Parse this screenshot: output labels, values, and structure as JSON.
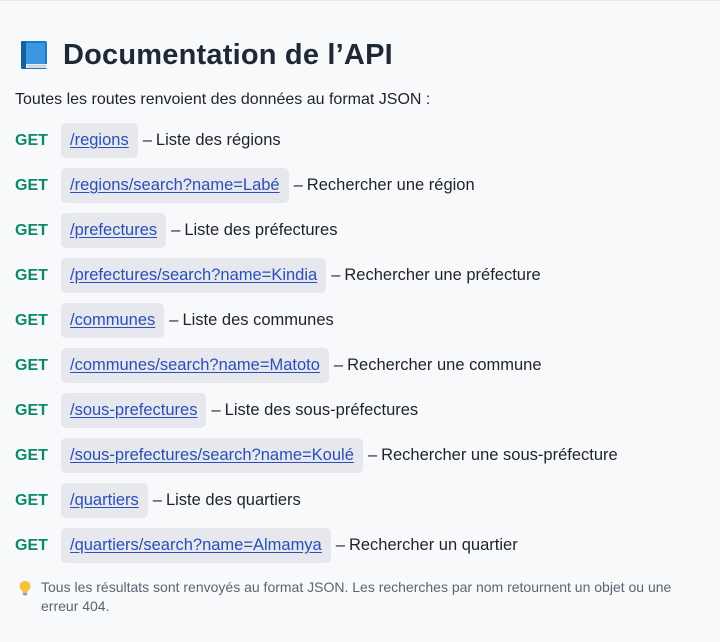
{
  "header": {
    "icon": "book-icon",
    "title": "Documentation de l’API"
  },
  "intro": "Toutes les routes renvoient des données au format JSON :",
  "separator": "–",
  "routes": [
    {
      "method": "GET",
      "path": "/regions",
      "description": "Liste des régions"
    },
    {
      "method": "GET",
      "path": "/regions/search?name=Labé",
      "description": "Rechercher une région"
    },
    {
      "method": "GET",
      "path": "/prefectures",
      "description": "Liste des préfectures"
    },
    {
      "method": "GET",
      "path": "/prefectures/search?name=Kindia",
      "description": "Rechercher une préfecture"
    },
    {
      "method": "GET",
      "path": "/communes",
      "description": "Liste des communes"
    },
    {
      "method": "GET",
      "path": "/communes/search?name=Matoto",
      "description": "Rechercher une commune"
    },
    {
      "method": "GET",
      "path": "/sous-prefectures",
      "description": "Liste des sous-préfectures"
    },
    {
      "method": "GET",
      "path": "/sous-prefectures/search?name=Koulé",
      "description": "Rechercher une sous-préfecture"
    },
    {
      "method": "GET",
      "path": "/quartiers",
      "description": "Liste des quartiers"
    },
    {
      "method": "GET",
      "path": "/quartiers/search?name=Almamya",
      "description": "Rechercher un quartier"
    }
  ],
  "note": {
    "icon": "lightbulb-icon",
    "text": "Tous les résultats sont renvoyés au format JSON. Les recherches par nom retournent un objet ou une erreur 404."
  },
  "colors": {
    "method": "#0a8a69",
    "link": "#2a4fb8",
    "chip": "#e6e8ed",
    "background": "#f8f9fb"
  }
}
